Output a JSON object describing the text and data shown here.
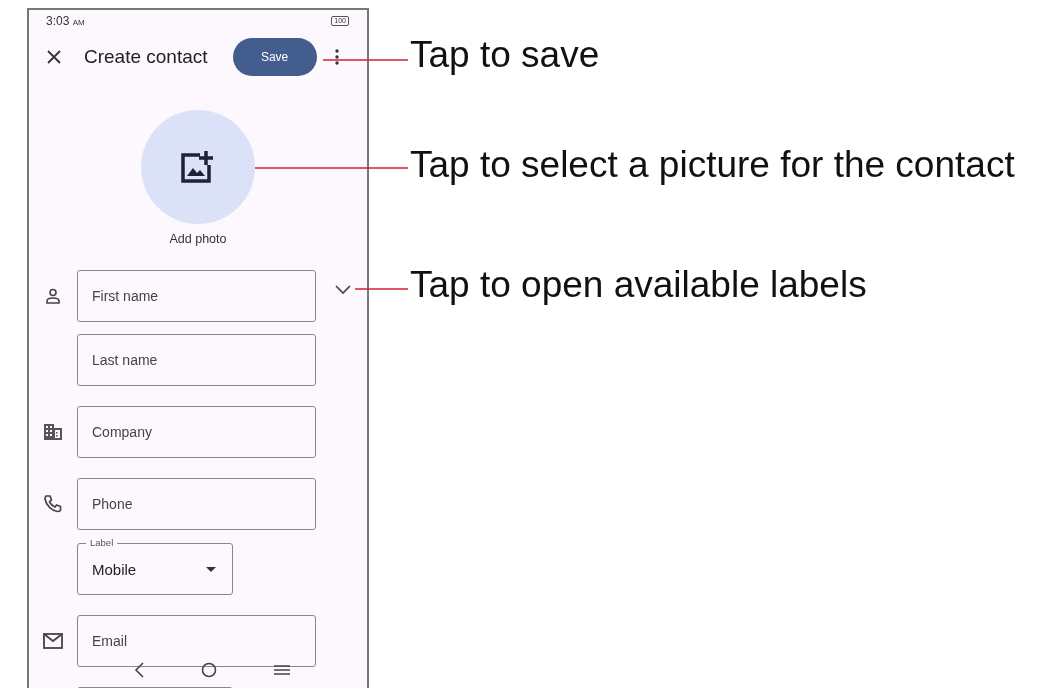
{
  "status_bar": {
    "time": "3:03",
    "meridiem": "AM",
    "battery": "100"
  },
  "toolbar": {
    "title": "Create contact",
    "save_button": "Save"
  },
  "photo": {
    "label": "Add photo"
  },
  "fields": [
    {
      "kind": "outlined",
      "placeholder": "First name"
    },
    {
      "kind": "outlined",
      "placeholder": "Last name"
    },
    {
      "kind": "outlined",
      "placeholder": "Company"
    },
    {
      "kind": "outlined",
      "placeholder": "Phone"
    },
    {
      "kind": "dropdown",
      "label": "Label",
      "value": "Mobile"
    },
    {
      "kind": "outlined",
      "placeholder": "Email"
    },
    {
      "kind": "dropdown"
    }
  ],
  "callouts": [
    {
      "text": "Tap to save"
    },
    {
      "text": "Tap to select a picture for the contact"
    },
    {
      "text": "Tap to open available labels"
    }
  ]
}
